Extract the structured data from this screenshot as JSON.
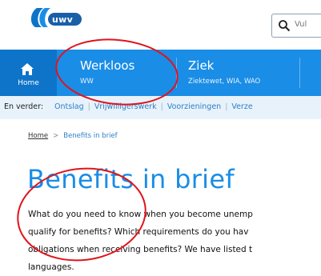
{
  "header": {
    "logo_text": "uwv",
    "search_placeholder": "Vul"
  },
  "nav": {
    "home_label": "Home",
    "items": [
      {
        "title": "Werkloos",
        "subtitle": "WW"
      },
      {
        "title": "Ziek",
        "subtitle": "Ziektewet, WIA, WAO"
      }
    ]
  },
  "subbar": {
    "label": "En verder:",
    "links": [
      "Ontslag",
      "Vrijwilligerswerk",
      "Voorzieningen",
      "Verze"
    ]
  },
  "breadcrumb": {
    "home": "Home",
    "separator": ">",
    "current": "Benefits in brief"
  },
  "page": {
    "title": "Benefits in brief",
    "intro_lines": [
      "What do you need to know when you become unemp",
      "qualify for benefits? Which requirements do you hav",
      "obligations when receiving benefits? We have listed t",
      "languages."
    ]
  },
  "colors": {
    "brand_blue": "#1a8de6",
    "home_blue": "#0e74c9",
    "annotation_red": "#e0141b"
  }
}
